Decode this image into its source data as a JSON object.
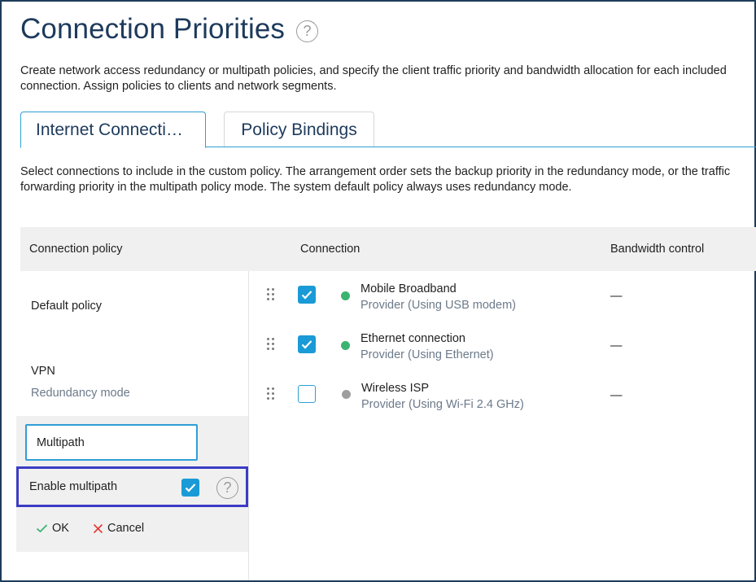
{
  "page": {
    "title": "Connection Priorities",
    "help_glyph": "?",
    "description": "Create network access redundancy or multipath policies, and specify the client traffic priority and bandwidth allocation for each included connection. Assign policies to clients and network segments."
  },
  "tabs": [
    {
      "label": "Internet Connecti…",
      "active": true
    },
    {
      "label": "Policy Bindings",
      "active": false
    }
  ],
  "tab_description": "Select connections to include in the custom policy. The arrangement order sets the backup priority in the redundancy mode, or the traffic forwarding priority in the multipath policy mode. The system default policy always uses redundancy mode.",
  "table": {
    "columns": {
      "policy": "Connection policy",
      "connection": "Connection",
      "bandwidth": "Bandwidth control"
    }
  },
  "policies": [
    {
      "name": "Default policy",
      "mode": ""
    },
    {
      "name": "VPN",
      "mode": "Redundancy mode"
    }
  ],
  "edit_policy": {
    "name_value": "Multipath",
    "enable_multipath_label": "Enable multipath",
    "enable_multipath_checked": true,
    "ok_label": "OK",
    "cancel_label": "Cancel"
  },
  "connections": [
    {
      "name": "Mobile Broadband",
      "provider": "Provider (Using USB modem)",
      "checked": true,
      "status_color": "#3cb371",
      "bandwidth": "—"
    },
    {
      "name": "Ethernet connection",
      "provider": "Provider (Using Ethernet)",
      "checked": true,
      "status_color": "#3cb371",
      "bandwidth": "—"
    },
    {
      "name": "Wireless ISP",
      "provider": "Provider (Using Wi-Fi 2.4 GHz)",
      "checked": false,
      "status_color": "#9e9e9e",
      "bandwidth": "—"
    }
  ],
  "colors": {
    "accent": "#1a9ad6",
    "title": "#1d3a5c",
    "highlight": "#3c3cc4",
    "ok_icon": "#3cb371",
    "cancel_icon": "#e53935"
  },
  "icons": {
    "drag_handle": "drag-handle-icon",
    "check": "check-icon",
    "cancel": "x-icon",
    "help": "help-icon"
  }
}
